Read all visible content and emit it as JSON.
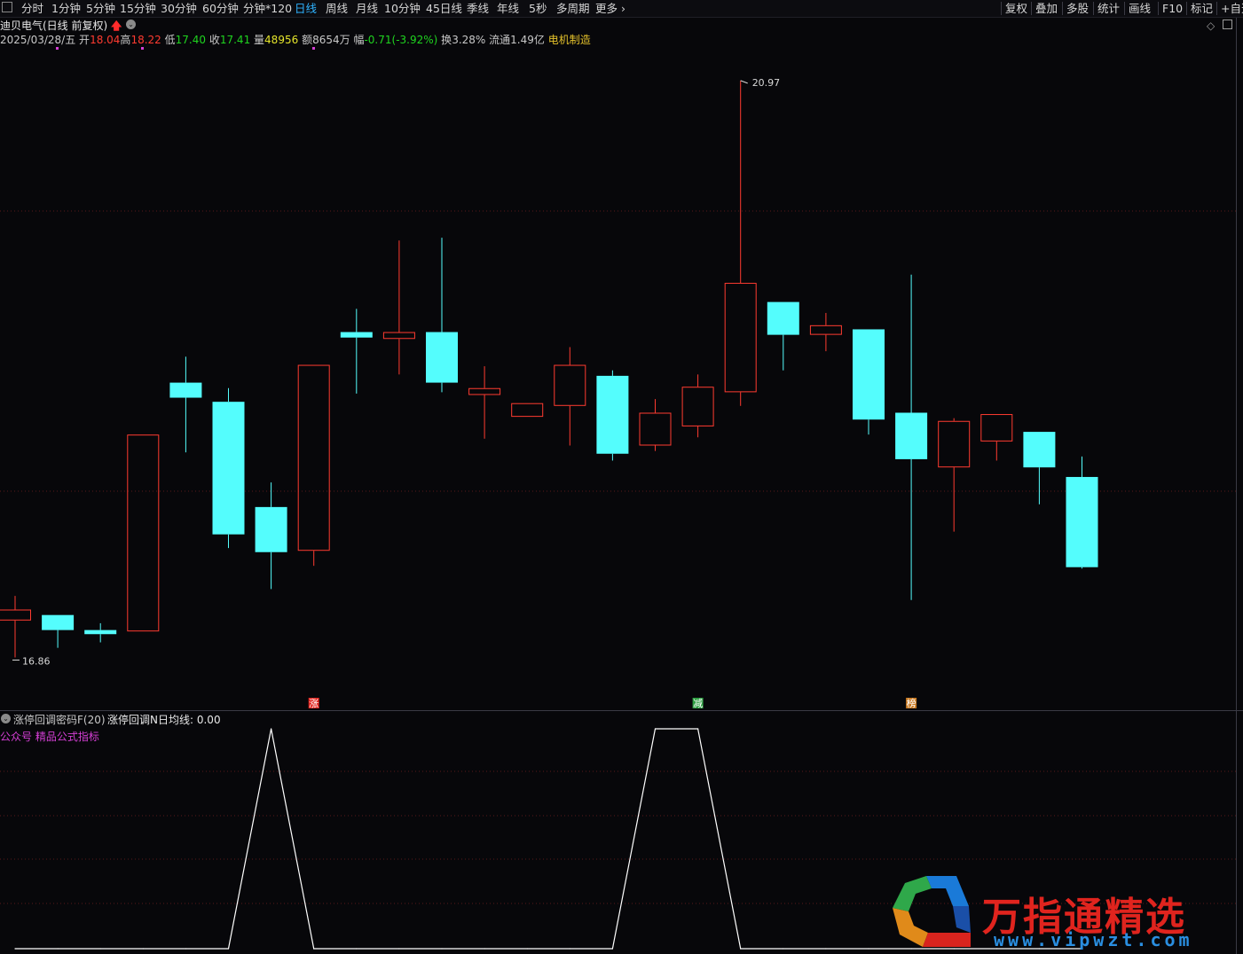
{
  "toolbar": {
    "left_items": [
      "分时",
      "1分钟",
      "5分钟",
      "15分钟",
      "30分钟",
      "60分钟",
      "分钟*120",
      "日线",
      "周线",
      "月线",
      "10分钟",
      "45日线",
      "季线",
      "年线",
      "5秒",
      "多周期",
      "更多"
    ],
    "active_item": "日线",
    "right_items": [
      "复权",
      "叠加",
      "多股",
      "统计",
      "画线",
      "F10",
      "标记",
      "+自选"
    ]
  },
  "header": {
    "title": "迪贝电气(日线 前复权)",
    "date": "2025/03/28/五",
    "open_label": "开",
    "open": "18.04",
    "high_label": "高",
    "high": "18.22",
    "low_label": "低",
    "low": "17.40",
    "close_label": "收",
    "close": "17.41",
    "volume_label": "量",
    "volume": "48956",
    "amount_label": "额",
    "amount": "8654万",
    "change_label": "幅",
    "change": "-0.71(-3.92%)",
    "turnover_label": "换",
    "turnover": "3.28%",
    "float_label": "流通",
    "float_value": "1.49亿",
    "industry": "电机制造"
  },
  "colors": {
    "up": "#ff3b30",
    "down": "#54fdfd",
    "bg": "#07070a",
    "grid": "#5a1a1a",
    "indicator_line": "#ffffff",
    "accent": "#2fb3ff"
  },
  "chart_data": {
    "type": "candlestick",
    "ylim": [
      16.5,
      21.3
    ],
    "max_marker": "20.97",
    "min_marker": "16.86",
    "candles": [
      {
        "o": 17.02,
        "h": 17.2,
        "l": 16.75,
        "c": 17.1
      },
      {
        "o": 17.06,
        "h": 17.06,
        "l": 16.82,
        "c": 16.95
      },
      {
        "o": 16.95,
        "h": 17.0,
        "l": 16.86,
        "c": 16.92
      },
      {
        "o": 16.94,
        "h": 18.38,
        "l": 16.94,
        "c": 18.38
      },
      {
        "o": 18.76,
        "h": 18.95,
        "l": 18.25,
        "c": 18.65
      },
      {
        "o": 18.62,
        "h": 18.72,
        "l": 17.55,
        "c": 17.65
      },
      {
        "o": 17.85,
        "h": 18.03,
        "l": 17.25,
        "c": 17.52
      },
      {
        "o": 17.53,
        "h": 18.89,
        "l": 17.42,
        "c": 18.89
      },
      {
        "o": 19.13,
        "h": 19.3,
        "l": 18.68,
        "c": 19.09
      },
      {
        "o": 19.08,
        "h": 19.8,
        "l": 18.82,
        "c": 19.13
      },
      {
        "o": 19.13,
        "h": 19.82,
        "l": 18.69,
        "c": 18.76
      },
      {
        "o": 18.67,
        "h": 18.88,
        "l": 18.35,
        "c": 18.72
      },
      {
        "o": 18.51,
        "h": 18.61,
        "l": 18.59,
        "c": 18.61
      },
      {
        "o": 18.59,
        "h": 19.02,
        "l": 18.3,
        "c": 18.89
      },
      {
        "o": 18.81,
        "h": 18.85,
        "l": 18.19,
        "c": 18.24
      },
      {
        "o": 18.3,
        "h": 18.64,
        "l": 18.26,
        "c": 18.54
      },
      {
        "o": 18.44,
        "h": 18.82,
        "l": 18.36,
        "c": 18.73
      },
      {
        "o": 18.69,
        "h": 20.97,
        "l": 18.59,
        "c": 19.49
      },
      {
        "o": 19.35,
        "h": 19.33,
        "l": 18.85,
        "c": 19.11
      },
      {
        "o": 19.11,
        "h": 19.27,
        "l": 18.99,
        "c": 19.18
      },
      {
        "o": 19.15,
        "h": 19.15,
        "l": 18.38,
        "c": 18.49
      },
      {
        "o": 18.54,
        "h": 19.55,
        "l": 17.17,
        "c": 18.2
      },
      {
        "o": 18.14,
        "h": 18.5,
        "l": 17.67,
        "c": 18.48
      },
      {
        "o": 18.33,
        "h": 18.5,
        "l": 18.19,
        "c": 18.53
      },
      {
        "o": 18.4,
        "h": 18.4,
        "l": 17.87,
        "c": 18.14
      },
      {
        "o": 18.07,
        "h": 18.22,
        "l": 17.4,
        "c": 17.41
      }
    ],
    "signals": [
      {
        "index": 7,
        "text": "涨",
        "color": "#e0241e"
      },
      {
        "index": 16,
        "text": "减",
        "color": "#2ea043"
      },
      {
        "index": 21,
        "text": "榜",
        "color": "#c87820"
      }
    ],
    "indicator": {
      "name": "涨停回调密码F(20)",
      "line_label": "涨停回调N日均线:",
      "line_value": "0.00",
      "note": "公众号 精品公式指标",
      "ylim": [
        0,
        1
      ],
      "values": [
        0,
        0,
        0,
        0,
        0,
        0,
        1,
        0,
        0,
        0,
        0,
        0,
        0,
        0,
        0,
        1,
        1,
        0,
        0,
        0,
        0,
        0,
        0,
        0,
        0,
        0
      ]
    }
  },
  "watermark": {
    "title": "万指通精选",
    "url": "www.vipwzt.com"
  }
}
